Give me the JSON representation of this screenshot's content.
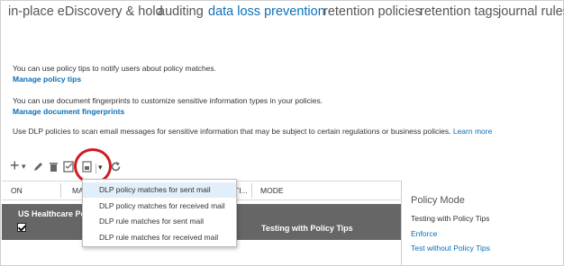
{
  "tabs": [
    {
      "label": "in-place eDiscovery & hold"
    },
    {
      "label": "auditing"
    },
    {
      "label": "data loss prevention"
    },
    {
      "label": "retention policies"
    },
    {
      "label": "retention tags"
    },
    {
      "label": "journal rules"
    }
  ],
  "active_tab": "data loss prevention",
  "info": {
    "tips_text": "You can use policy tips to notify users about policy matches.",
    "tips_link": "Manage policy tips",
    "fingerprint_text": "You can use document fingerprints to customize sensitive information types in your policies.",
    "fingerprint_link": "Manage document fingerprints",
    "dlp_text": "Use DLP policies to scan email messages for sensitive information that may be subject to certain regulations or business policies.",
    "learn_more": "Learn more"
  },
  "toolbar": {
    "add": "+",
    "add_dropdown": "▾",
    "report_dropdown": "▾"
  },
  "table": {
    "headers": {
      "on": "ON",
      "name": "MA",
      "status": "TI...",
      "mode": "MODE"
    },
    "row": {
      "name": "US Healthcare Po",
      "mode": "Testing with Policy Tips",
      "checked": true
    }
  },
  "menu": {
    "items": [
      {
        "label": "DLP policy matches for sent mail",
        "hover": true
      },
      {
        "label": "DLP policy matches for received mail",
        "hover": false
      },
      {
        "label": "DLP rule matches for sent mail",
        "hover": false
      },
      {
        "label": "DLP rule matches for received mail",
        "hover": false
      }
    ]
  },
  "detail": {
    "title": "Policy Mode",
    "mode": "Testing with Policy Tips",
    "link1": "Enforce",
    "link2": "Test without Policy Tips"
  },
  "colors": {
    "accent": "#0a6fb8",
    "highlight": "#d11a1f",
    "row_selected": "#666666"
  }
}
